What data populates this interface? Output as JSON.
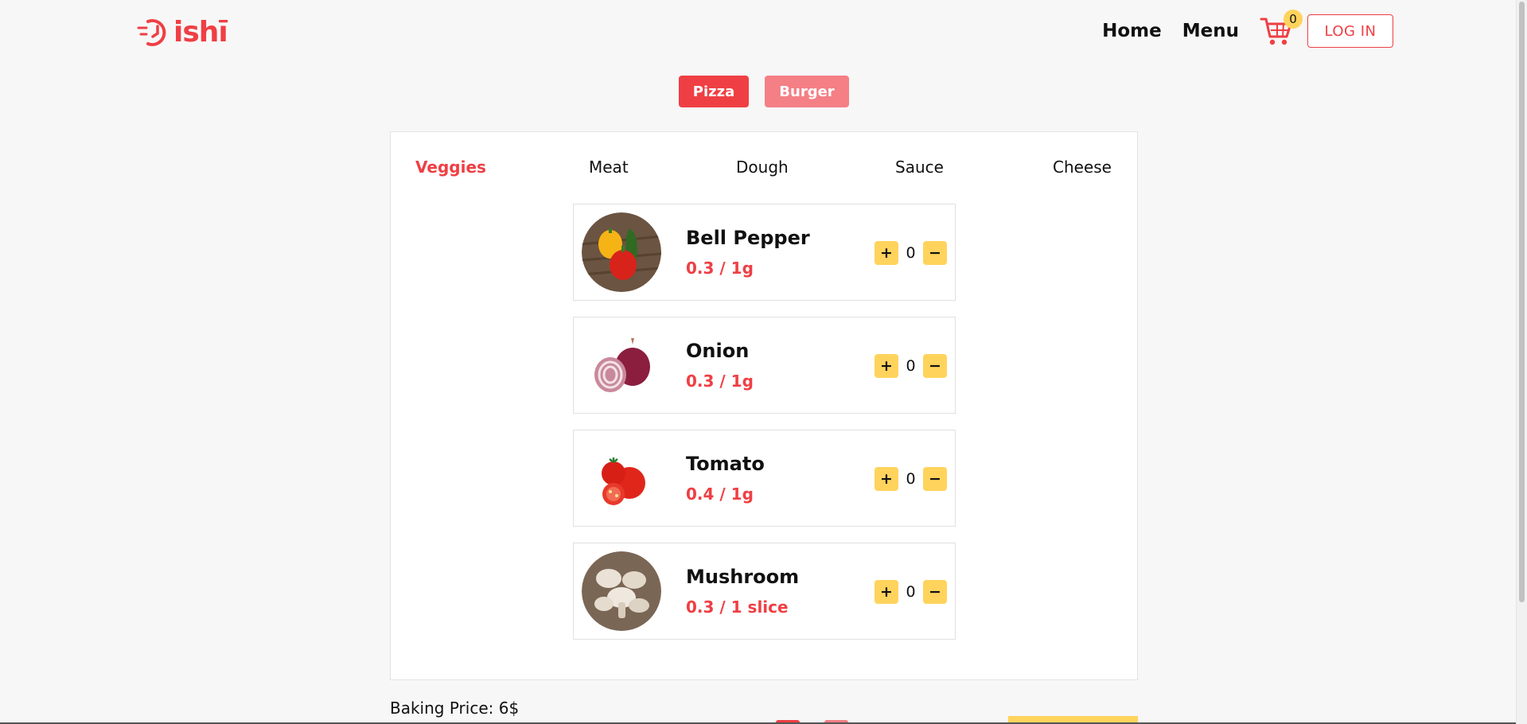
{
  "brand": {
    "logo_text": "ishī",
    "color": "#ef3f44"
  },
  "nav": {
    "home": "Home",
    "menu": "Menu",
    "cart_count": "0",
    "login": "LOG IN"
  },
  "categories": [
    {
      "label": "Pizza",
      "active": true
    },
    {
      "label": "Burger",
      "active": false
    }
  ],
  "tabs": [
    {
      "label": "Veggies",
      "active": true
    },
    {
      "label": "Meat",
      "active": false
    },
    {
      "label": "Dough",
      "active": false
    },
    {
      "label": "Sauce",
      "active": false
    },
    {
      "label": "Cheese",
      "active": false
    }
  ],
  "items": [
    {
      "name": "Bell Pepper",
      "price": "0.3 / 1g",
      "qty": "0",
      "image_icon": "bell-pepper-image"
    },
    {
      "name": "Onion",
      "price": "0.3 / 1g",
      "qty": "0",
      "image_icon": "onion-image"
    },
    {
      "name": "Tomato",
      "price": "0.4 / 1g",
      "qty": "0",
      "image_icon": "tomato-image"
    },
    {
      "name": "Mushroom",
      "price": "0.3 / 1 slice",
      "qty": "0",
      "image_icon": "mushroom-image"
    }
  ],
  "qty_controls": {
    "plus": "+",
    "minus": "−"
  },
  "footer": {
    "baking_price": "Baking Price: 6$"
  },
  "colors": {
    "accent": "#ef3f44",
    "accent_light": "#f47f85",
    "yellow": "#ffd35c"
  }
}
